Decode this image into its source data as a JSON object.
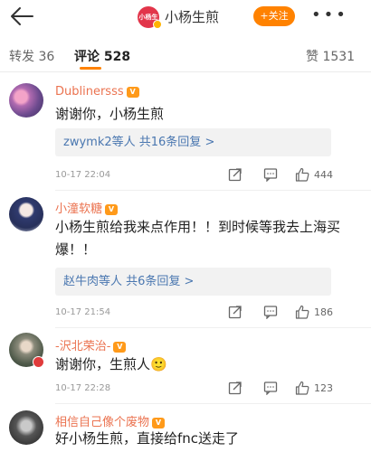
{
  "header": {
    "back_icon": "back-arrow-icon",
    "brand_avatar_text": "小杨生煎",
    "title": "小杨生煎",
    "follow_label": "+关注",
    "more_icon": "more-dots-icon"
  },
  "tabs": {
    "repost": "转发 36",
    "comments": "评论 528",
    "likes": "赞 1531"
  },
  "comments": [
    {
      "user": "Dublinersss",
      "text": "谢谢你，小杨生煎",
      "reply_who": "zwymk2等人",
      "reply_count": "共16条回复 >",
      "time": "10-17 22:04",
      "likes": "444"
    },
    {
      "user": "小潼软糖",
      "text": "小杨生煎给我来点作用！！到时候等我去上海买爆！！",
      "reply_who": "赵牛肉等人",
      "reply_count": "共6条回复 >",
      "time": "10-17 21:54",
      "likes": "186"
    },
    {
      "user": "-沢北荣治-",
      "text": "谢谢你，生煎人🙂",
      "time": "10-17 22:28",
      "likes": "123"
    },
    {
      "user": "相信自己像个废物",
      "text": "好小杨生煎，直接给fnc送走了"
    }
  ],
  "colors": {
    "accent": "#ff8200",
    "username": "#eb7350",
    "link": "#4a77b0"
  }
}
